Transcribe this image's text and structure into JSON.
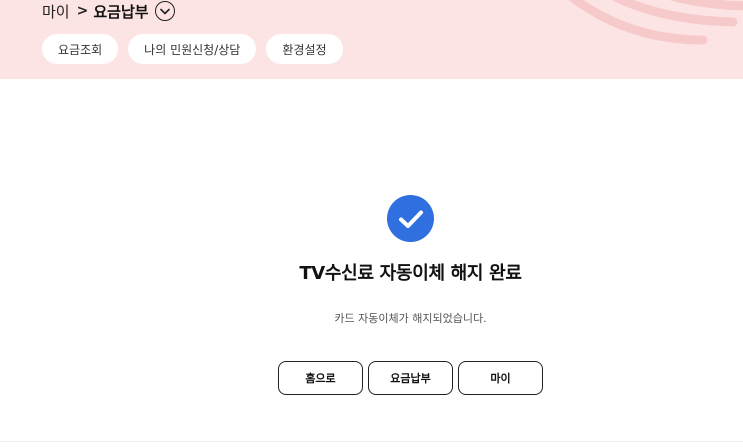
{
  "header": {
    "breadcrumb": {
      "home": "마이",
      "separator": ">",
      "current": "요금납부"
    },
    "toggle_icon": "chevron-down-circle-icon",
    "chips": [
      {
        "label": "요금조회"
      },
      {
        "label": "나의 민원신청/상담"
      },
      {
        "label": "환경설정"
      }
    ],
    "colors": {
      "background": "#fde4e4",
      "decoration": "#f8cfcf"
    }
  },
  "result": {
    "icon": "check-circle-icon",
    "icon_color": "#2f6fe0",
    "title": "TV수신료 자동이체 해지 완료",
    "description": "카드 자동이체가 해지되었습니다."
  },
  "actions": {
    "home_label": "홈으로",
    "payment_label": "요금납부",
    "my_label": "마이"
  }
}
